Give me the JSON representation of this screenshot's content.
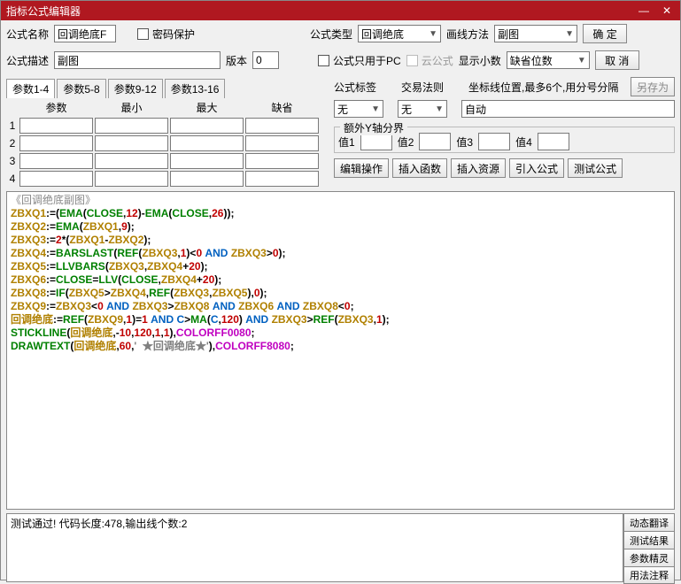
{
  "title": "指标公式编辑器",
  "winbtns": {
    "min": "—",
    "close": "✕"
  },
  "row1": {
    "name_lbl": "公式名称",
    "name_val": "回调绝底F",
    "pw_lbl": "密码保护",
    "type_lbl": "公式类型",
    "type_val": "回调绝底",
    "draw_lbl": "画线方法",
    "draw_val": "副图",
    "ok": "确  定"
  },
  "row2": {
    "desc_lbl": "公式描述",
    "desc_val": "副图",
    "ver_lbl": "版本",
    "ver_val": "0",
    "pconly": "公式只用于PC",
    "cloud": "云公式",
    "decimal_lbl": "显示小数",
    "decimal_val": "缺省位数",
    "cancel": "取  消"
  },
  "paramtabs": [
    "参数1-4",
    "参数5-8",
    "参数9-12",
    "参数13-16"
  ],
  "paramhdr": [
    "参数",
    "最小",
    "最大",
    "缺省"
  ],
  "paramrows": [
    "1",
    "2",
    "3",
    "4"
  ],
  "ur": {
    "tag_lbl": "公式标签",
    "trade_lbl": "交易法则",
    "coord_lbl": "坐标线位置,最多6个,用分号分隔",
    "tag_val": "无",
    "trade_val": "无",
    "coord_val": "自动",
    "saveas": "另存为"
  },
  "yaxis": {
    "legend": "额外Y轴分界",
    "v1": "值1",
    "v2": "值2",
    "v3": "值3",
    "v4": "值4"
  },
  "btnrow": [
    "编辑操作",
    "插入函数",
    "插入资源",
    "引入公式",
    "测试公式"
  ],
  "code_header": "《回调绝底副图》",
  "code_lines": [
    {
      "t": "ZBXQ1:=(EMA(CLOSE,12)-EMA(CLOSE,26));"
    },
    {
      "t": "ZBXQ2:=EMA(ZBXQ1,9);"
    },
    {
      "t": "ZBXQ3:=2*(ZBXQ1-ZBXQ2);"
    },
    {
      "t": "ZBXQ4:=BARSLAST(REF(ZBXQ3,1)<0 AND ZBXQ3>0);"
    },
    {
      "t": "ZBXQ5:=LLVBARS(ZBXQ3,ZBXQ4+20);"
    },
    {
      "t": "ZBXQ6:=CLOSE=LLV(CLOSE,ZBXQ4+20);"
    },
    {
      "t": "ZBXQ8:=IF(ZBXQ5>ZBXQ4,REF(ZBXQ3,ZBXQ5),0);"
    },
    {
      "t": "ZBXQ9:=ZBXQ3<0 AND ZBXQ3>ZBXQ8 AND ZBXQ6 AND ZBXQ8<0;"
    },
    {
      "t": "回调绝底:=REF(ZBXQ9,1)=1 AND C>MA(C,120) AND ZBXQ3>REF(ZBXQ3,1);"
    },
    {
      "t": "STICKLINE(回调绝底,-10,120,1,1),COLORFF0080;"
    },
    {
      "t": "DRAWTEXT(回调绝底,60,'  ★回调绝底★'),COLORFF8080;"
    }
  ],
  "status": "测试通过! 代码长度:478,输出线个数:2",
  "sidebtns": [
    "动态翻译",
    "测试结果",
    "参数精灵",
    "用法注释"
  ]
}
